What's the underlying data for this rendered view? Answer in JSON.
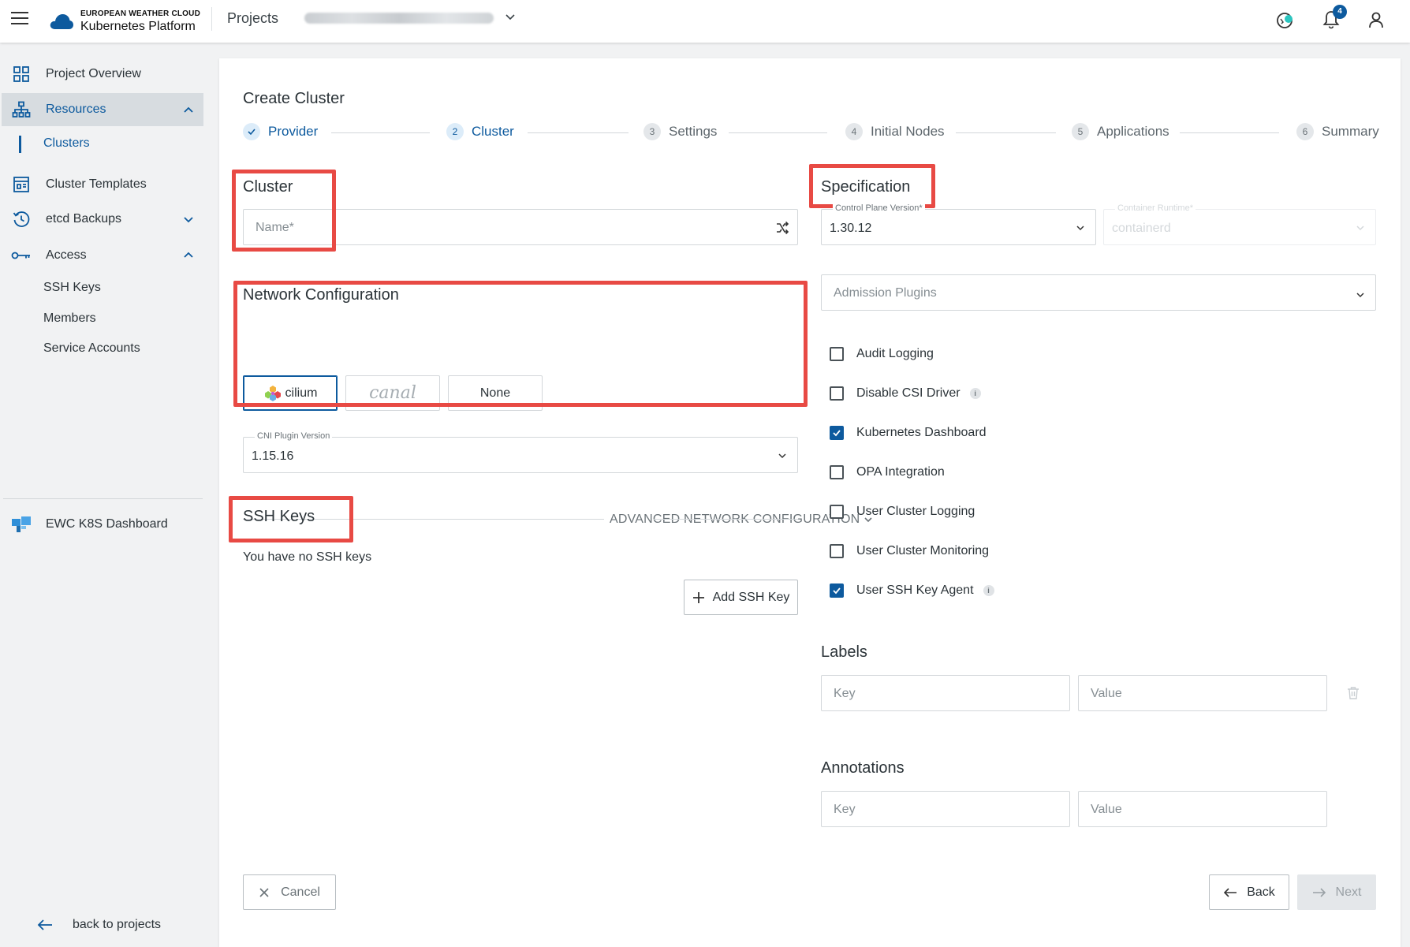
{
  "brand": {
    "line1": "EUROPEAN WEATHER CLOUD",
    "line2": "Kubernetes Platform"
  },
  "topbar": {
    "projects_label": "Projects",
    "notification_count": "4"
  },
  "sidebar": {
    "items": [
      {
        "label": "Project Overview"
      },
      {
        "label": "Resources"
      },
      {
        "label": "Clusters"
      },
      {
        "label": "Cluster Templates"
      },
      {
        "label": "etcd Backups"
      },
      {
        "label": "Access"
      },
      {
        "label": "SSH Keys"
      },
      {
        "label": "Members"
      },
      {
        "label": "Service Accounts"
      },
      {
        "label": "EWC K8S Dashboard"
      }
    ],
    "back_label": "back to projects"
  },
  "page": {
    "title": "Create Cluster"
  },
  "stepper": [
    {
      "num": "1",
      "label": "Provider"
    },
    {
      "num": "2",
      "label": "Cluster"
    },
    {
      "num": "3",
      "label": "Settings"
    },
    {
      "num": "4",
      "label": "Initial Nodes"
    },
    {
      "num": "5",
      "label": "Applications"
    },
    {
      "num": "6",
      "label": "Summary"
    }
  ],
  "cluster": {
    "title": "Cluster",
    "name_placeholder": "Name*"
  },
  "network": {
    "title": "Network Configuration",
    "options": [
      "cilium",
      "canal",
      "None"
    ],
    "cni_label": "CNI Plugin Version",
    "cni_value": "1.15.16",
    "advanced_label": "ADVANCED NETWORK CONFIGURATION"
  },
  "ssh": {
    "title": "SSH Keys",
    "empty_text": "You have no SSH keys",
    "add_label": "Add SSH Key"
  },
  "spec": {
    "title": "Specification",
    "cp_label": "Control Plane Version*",
    "cp_value": "1.30.12",
    "runtime_label": "Container Runtime*",
    "runtime_value": "containerd",
    "admission_placeholder": "Admission Plugins",
    "checkboxes": [
      {
        "label": "Audit Logging",
        "checked": false
      },
      {
        "label": "Disable CSI Driver",
        "checked": false
      },
      {
        "label": "Kubernetes Dashboard",
        "checked": true
      },
      {
        "label": "OPA Integration",
        "checked": false
      },
      {
        "label": "User Cluster Logging",
        "checked": false
      },
      {
        "label": "User Cluster Monitoring",
        "checked": false
      },
      {
        "label": "User SSH Key Agent",
        "checked": true
      }
    ]
  },
  "labels": {
    "title": "Labels",
    "key_placeholder": "Key",
    "value_placeholder": "Value"
  },
  "annotations": {
    "title": "Annotations",
    "key_placeholder": "Key",
    "value_placeholder": "Value"
  },
  "footer": {
    "cancel_label": "Cancel",
    "back_label": "Back",
    "next_label": "Next"
  },
  "colors": {
    "accent": "#0d5a9e",
    "highlight": "#e84a44"
  }
}
